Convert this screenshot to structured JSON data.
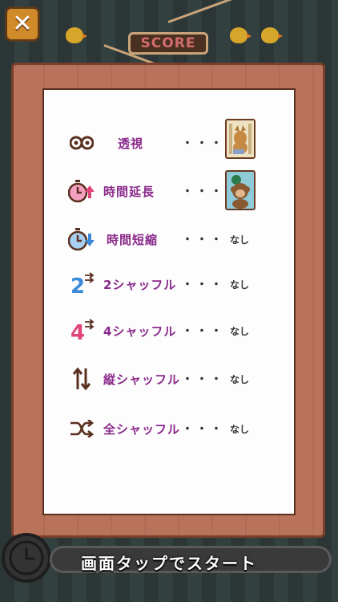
{
  "header": {
    "close_symbol": "✕",
    "score_label": "SCORE"
  },
  "items": [
    {
      "icon": "binoculars-icon",
      "label": "透視",
      "dots": "・・・",
      "value": "",
      "thumb": "cat-card"
    },
    {
      "icon": "timer-up-icon",
      "label": "時間延長",
      "dots": "・・・",
      "value": "",
      "thumb": "monkey-card"
    },
    {
      "icon": "timer-down-icon",
      "label": "時間短縮",
      "dots": "・・・",
      "value": "なし"
    },
    {
      "icon": "shuffle-2-icon",
      "label": "2シャッフル",
      "dots": "・・・",
      "value": "なし"
    },
    {
      "icon": "shuffle-4-icon",
      "label": "4シャッフル",
      "dots": "・・・",
      "value": "なし"
    },
    {
      "icon": "vertical-shuffle-icon",
      "label": "縦シャッフル",
      "dots": "・・・",
      "value": "なし"
    },
    {
      "icon": "all-shuffle-icon",
      "label": "全シャッフル",
      "dots": "・・・",
      "value": "なし"
    }
  ],
  "footer": {
    "tap_to_start": "画面タップでスタート"
  },
  "colors": {
    "label_purple": "#8a2a8a",
    "board_wood": "#b8735a",
    "accent_pink": "#e0447a",
    "accent_blue": "#3a8ad8"
  }
}
